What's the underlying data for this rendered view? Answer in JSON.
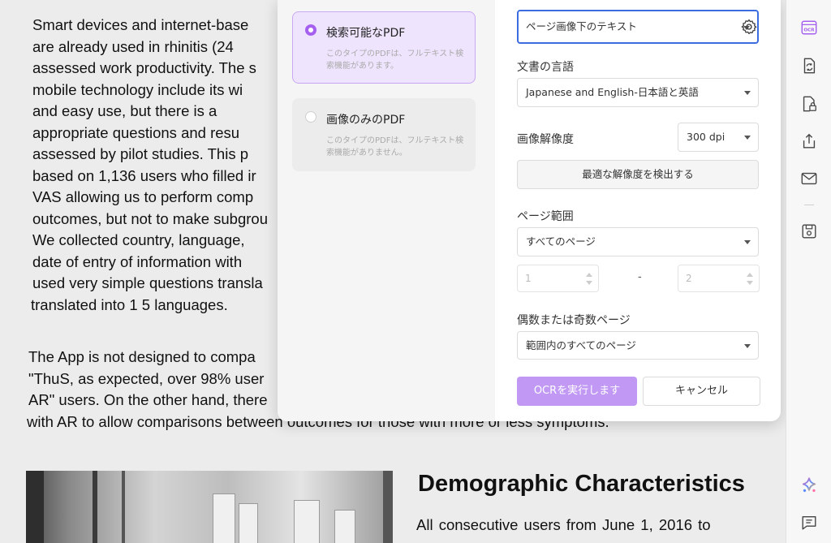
{
  "document": {
    "paragraph1_lines": [
      "Smart devices and internet-base",
      "are already used in rhinitis (24",
      "assessed work productivity. The s",
      "mobile technology include its wi",
      "and easy use, but there is a",
      "appropriate questions and resu",
      "assessed by pilot studies. This p",
      "based on 1,136 users who filled ir",
      "VAS allowing us to perform comp",
      "outcomes, but not to make subgrou",
      "We collected country, language,",
      "date of entry of information with",
      "used very simple questions transla",
      "translated into 1 5 languages."
    ],
    "paragraph2_lines": [
      "The App is not designed to compa",
      "\"ThuS, as expected, over 98% user",
      "AR\" users. On the other hand, there",
      "with AR to allow comparisons between outcomes for those with more or less symptoms."
    ],
    "heading": "Demographic Characteristics",
    "paragraph3_first_line": "All  consecutive  users  from  June  1,  2016  to"
  },
  "ocr_panel": {
    "output_options": [
      {
        "title": "検索可能なPDF",
        "description": "このタイプのPDFは、フルテキスト検索機能があります。",
        "selected": true
      },
      {
        "title": "画像のみのPDF",
        "description": "このタイプのPDFは、フルテキスト検索機能がありません。",
        "selected": false
      }
    ],
    "layout_select": "ページ画像下のテキスト",
    "language_label": "文書の言語",
    "language_select": "Japanese and English-日本語と英語",
    "resolution_label": "画像解像度",
    "resolution_select": "300 dpi",
    "detect_button": "最適な解像度を検出する",
    "page_range_label": "ページ範囲",
    "page_range_select": "すべてのページ",
    "range_from": "1",
    "range_separator": "-",
    "range_to": "2",
    "odd_even_label": "偶数または奇数ページ",
    "odd_even_select": "範囲内のすべてのページ",
    "run_button": "OCRを実行します",
    "cancel_button": "キャンセル"
  },
  "toolbar": {
    "icons": [
      "ocr-icon",
      "convert-icon",
      "protect-icon",
      "share-icon",
      "email-icon",
      "save-icon",
      "ai-assistant-icon",
      "comment-icon"
    ]
  },
  "colors": {
    "accent": "#a560ef",
    "run_button": "#c199f4",
    "focus_border": "#3d6be0",
    "ai_icon_gradient": [
      "#ff6fa8",
      "#5b8cff",
      "#ffb347"
    ]
  }
}
